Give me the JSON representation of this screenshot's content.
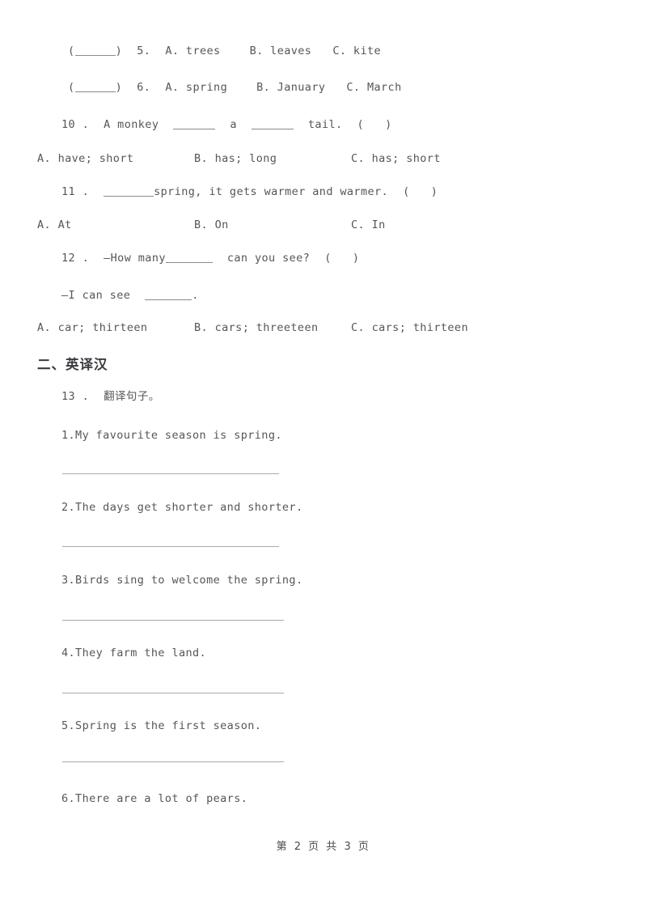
{
  "document": {
    "page_background": "#ffffff",
    "text_color": "#56565b",
    "rule_color": "#a9a9ae"
  },
  "multiple_choice_bracket_rows": [
    {
      "bracket_open": "(",
      "bracket_close": ")",
      "number": "5.",
      "option_a": "A. trees",
      "option_b": "B. leaves",
      "option_c": "C. kite"
    },
    {
      "bracket_open": "(",
      "bracket_close": ")",
      "number": "6.",
      "option_a": "A. spring",
      "option_b": "B. January",
      "option_c": "C. March"
    }
  ],
  "questions": [
    {
      "number": "10 .",
      "stem_part1": "A monkey",
      "stem_part2": "a",
      "stem_part3": "tail.",
      "paren_open": "(",
      "paren_close": ")",
      "options": [
        "A. have; short",
        "B. has; long",
        "C. has; short"
      ]
    },
    {
      "number": "11 .",
      "stem_part1": "",
      "stem_part2": "spring, it gets warmer and warmer.",
      "paren_open": "(",
      "paren_close": ")",
      "options": [
        "A. At",
        "B. On",
        "C. In"
      ]
    },
    {
      "number": "12 .",
      "stem_part1": "—How many",
      "stem_part2": "can you see?",
      "paren_open": "(",
      "paren_close": ")",
      "answer_line": "—I can see",
      "answer_line_end": ".",
      "options": [
        "A. car;  thirteen",
        "B. cars;  threeteen",
        "C. cars;  thirteen"
      ]
    }
  ],
  "section_two": {
    "heading": "二、英译汉",
    "task_number": "13 .",
    "task_label": "翻译句子。",
    "items": [
      "1.My favourite season is spring.",
      "2.The days get shorter and shorter.",
      "3.Birds sing to welcome the spring.",
      "4.They farm the land.",
      "5.Spring is the first season.",
      "6.There are a lot of pears."
    ]
  },
  "footer": {
    "text": "第 2 页 共 3 页"
  }
}
